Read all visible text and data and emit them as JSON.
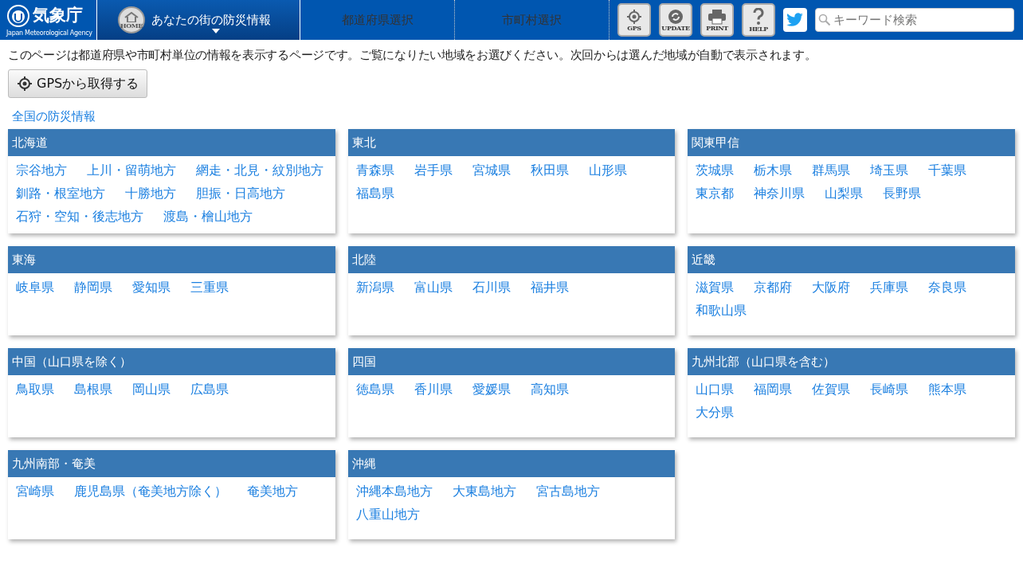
{
  "header": {
    "logo": {
      "name": "気象庁",
      "subtitle": "Japan Meteorological Agency"
    },
    "home": {
      "icon_label": "HOME",
      "title": "あなたの街の防災情報"
    },
    "tabs": [
      {
        "label": "都道府県選択",
        "disabled": true
      },
      {
        "label": "市町村選択",
        "disabled": true
      }
    ],
    "tools": [
      {
        "kind": "gps",
        "label": "GPS"
      },
      {
        "kind": "update",
        "label": "UPDATE"
      },
      {
        "kind": "print",
        "label": "PRINT"
      },
      {
        "kind": "help",
        "label": "HELP"
      }
    ],
    "search": {
      "placeholder": "キーワード検索"
    }
  },
  "intro": "このページは都道府県や市町村単位の情報を表示するページです。ご覧になりたい地域をお選びください。次回からは選んだ地域が自動で表示されます。",
  "gps_button": "GPSから取得する",
  "national_link": "全国の防災情報",
  "regions": [
    {
      "title": "北海道",
      "links": [
        "宗谷地方",
        "上川・留萌地方",
        "網走・北見・紋別地方",
        "釧路・根室地方",
        "十勝地方",
        "胆振・日高地方",
        "石狩・空知・後志地方",
        "渡島・檜山地方"
      ]
    },
    {
      "title": "東北",
      "links": [
        "青森県",
        "岩手県",
        "宮城県",
        "秋田県",
        "山形県",
        "福島県"
      ]
    },
    {
      "title": "関東甲信",
      "links": [
        "茨城県",
        "栃木県",
        "群馬県",
        "埼玉県",
        "千葉県",
        "東京都",
        "神奈川県",
        "山梨県",
        "長野県"
      ]
    },
    {
      "title": "東海",
      "links": [
        "岐阜県",
        "静岡県",
        "愛知県",
        "三重県"
      ]
    },
    {
      "title": "北陸",
      "links": [
        "新潟県",
        "富山県",
        "石川県",
        "福井県"
      ]
    },
    {
      "title": "近畿",
      "links": [
        "滋賀県",
        "京都府",
        "大阪府",
        "兵庫県",
        "奈良県",
        "和歌山県"
      ]
    },
    {
      "title": "中国（山口県を除く）",
      "links": [
        "鳥取県",
        "島根県",
        "岡山県",
        "広島県"
      ]
    },
    {
      "title": "四国",
      "links": [
        "徳島県",
        "香川県",
        "愛媛県",
        "高知県"
      ]
    },
    {
      "title": "九州北部（山口県を含む）",
      "links": [
        "山口県",
        "福岡県",
        "佐賀県",
        "長崎県",
        "熊本県",
        "大分県"
      ]
    },
    {
      "title": "九州南部・奄美",
      "links": [
        "宮崎県",
        "鹿児島県（奄美地方除く）",
        "奄美地方"
      ]
    },
    {
      "title": "沖縄",
      "links": [
        "沖縄本島地方",
        "大東島地方",
        "宮古島地方",
        "八重山地方"
      ]
    }
  ]
}
